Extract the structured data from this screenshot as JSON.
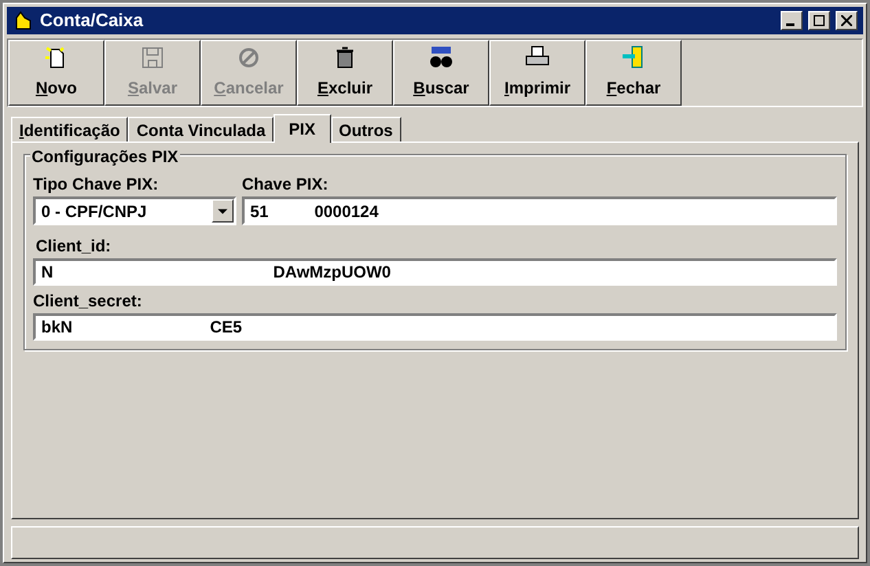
{
  "window": {
    "title": "Conta/Caixa"
  },
  "toolbar": [
    {
      "kind": "new",
      "label": "Novo",
      "disabled": false,
      "underline_first": true
    },
    {
      "kind": "save",
      "label": "Salvar",
      "disabled": true,
      "underline_first": true
    },
    {
      "kind": "cancel",
      "label": "Cancelar",
      "disabled": true,
      "underline_first": true
    },
    {
      "kind": "delete",
      "label": "Excluir",
      "disabled": false,
      "underline_first": true
    },
    {
      "kind": "search",
      "label": "Buscar",
      "disabled": false,
      "underline_first": true
    },
    {
      "kind": "print",
      "label": "Imprimir",
      "disabled": false,
      "underline_first": true
    },
    {
      "kind": "close",
      "label": "Fechar",
      "disabled": false,
      "underline_first": true
    }
  ],
  "tabs": [
    {
      "label": "Identificação",
      "selected": false,
      "underline_first": true
    },
    {
      "label": "Conta Vinculada",
      "selected": false,
      "underline_first": false
    },
    {
      "label": "PIX",
      "selected": true,
      "underline_first": false
    },
    {
      "label": "Outros",
      "selected": false,
      "underline_first": false
    }
  ],
  "group": {
    "title": "Configurações PIX",
    "tipo_chave": {
      "label": "Tipo Chave PIX:",
      "value": "0 - CPF/CNPJ"
    },
    "chave": {
      "label": "Chave PIX:",
      "value": "51          0000124"
    },
    "client_id": {
      "label": "Client_id:",
      "value": "N                                                DAwMzpUOW0"
    },
    "client_secret": {
      "label": "Client_secret:",
      "value": "bkN                              CE5"
    }
  }
}
